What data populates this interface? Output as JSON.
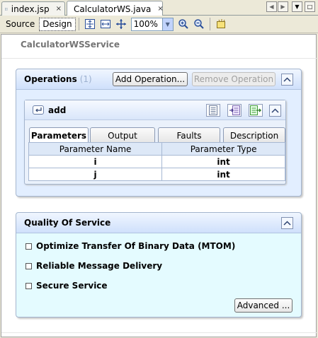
{
  "tabs": [
    {
      "label": "index.jsp",
      "active": false
    },
    {
      "label": "CalculatorWS.java",
      "active": true
    }
  ],
  "tab_close": "×",
  "toolbar": {
    "source_label": "Source",
    "design_label": "Design",
    "zoom_value": "100%"
  },
  "service_title": "CalculatorWSService",
  "operations": {
    "title": "Operations",
    "count": "(1)",
    "add_button": "Add Operation...",
    "remove_button": "Remove Operation",
    "operation": {
      "name": "add",
      "tabs": [
        "Parameters",
        "Output",
        "Faults",
        "Description"
      ],
      "active_tab": "Parameters",
      "columns": [
        "Parameter Name",
        "Parameter Type"
      ],
      "rows": [
        {
          "name": "i",
          "type": "int"
        },
        {
          "name": "j",
          "type": "int"
        }
      ]
    }
  },
  "qos": {
    "title": "Quality Of Service",
    "items": [
      {
        "label": "Optimize Transfer Of Binary Data (MTOM)",
        "checked": false
      },
      {
        "label": "Reliable Message Delivery",
        "checked": false
      },
      {
        "label": "Secure Service",
        "checked": false
      }
    ],
    "advanced_button": "Advanced ..."
  },
  "colors": {
    "panel_bg": "#e2eeff",
    "qos_bg": "#e4fbff",
    "accent": "#4d6185"
  }
}
